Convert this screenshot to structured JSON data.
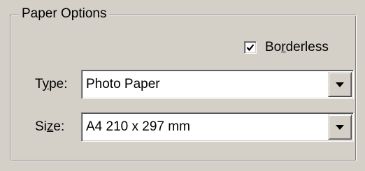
{
  "group": {
    "title": "Paper Options"
  },
  "borderless": {
    "label": "Borderless",
    "checked": true
  },
  "type": {
    "label": "Type:",
    "value": "Photo Paper"
  },
  "size": {
    "label": "Size:",
    "value": "A4 210 x 297 mm"
  },
  "icons": {
    "check": "checkmark-icon",
    "dropdown": "down-arrow-icon"
  }
}
